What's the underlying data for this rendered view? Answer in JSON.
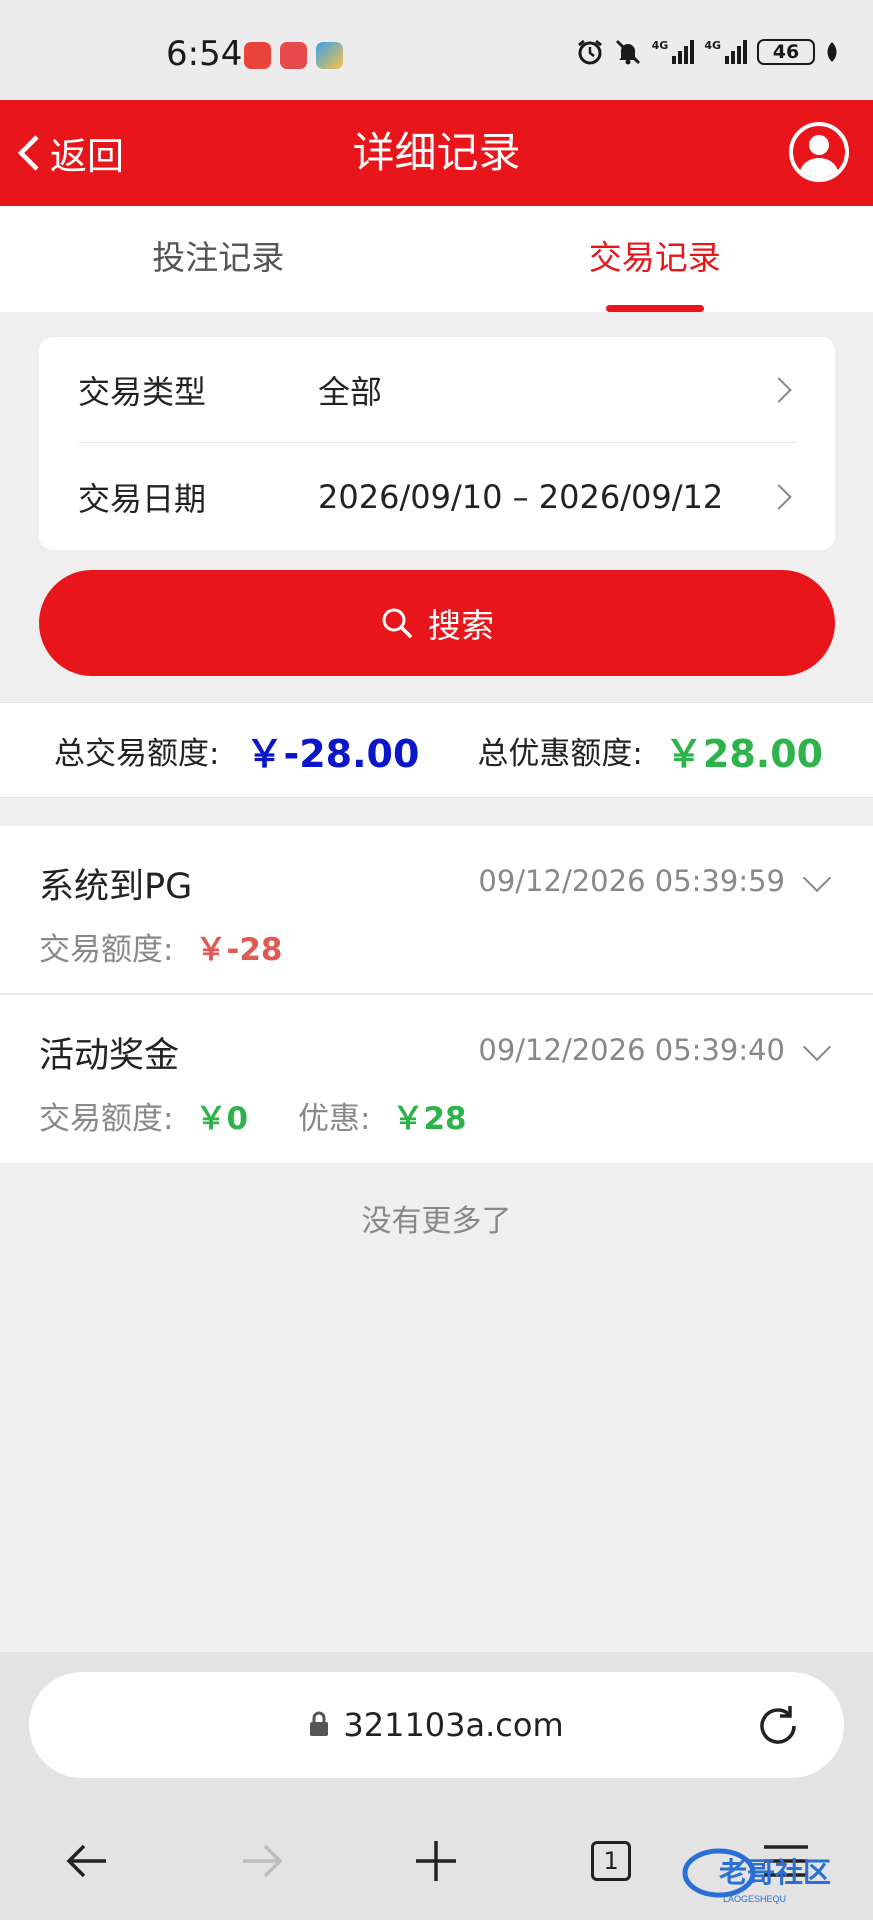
{
  "status_bar": {
    "time": "6:54",
    "app_icons": [
      "phone-app-icon",
      "huawei-appgallery-icon",
      "weather-app-icon"
    ],
    "status_icons": [
      "alarm-icon",
      "mute-icon",
      "signal-4g-icon",
      "signal-4g-icon"
    ],
    "signal_label_1": "4G",
    "signal_label_2": "4G",
    "battery": "46"
  },
  "header": {
    "back_label": "返回",
    "title": "详细记录",
    "accent_color": "#e8161b"
  },
  "tabs": [
    {
      "label": "投注记录",
      "active": false
    },
    {
      "label": "交易记录",
      "active": true
    }
  ],
  "filter": {
    "type_label": "交易类型",
    "type_value": "全部",
    "date_label": "交易日期",
    "date_value": "2026/09/10 – 2026/09/12"
  },
  "search": {
    "label": "搜索"
  },
  "totals": {
    "trade_label": "总交易额度:",
    "trade_value": "￥-28.00",
    "bonus_label": "总优惠额度:",
    "bonus_value": "￥28.00"
  },
  "records": [
    {
      "title": "系统到PG",
      "time": "09/12/2026 05:39:59",
      "amount_label": "交易额度:",
      "amount": "￥-28"
    },
    {
      "title": "活动奖金",
      "time": "09/12/2026 05:39:40",
      "amount_label": "交易额度:",
      "amount": "￥0",
      "bonus_label": "优惠:",
      "bonus": "￥28"
    }
  ],
  "no_more": "没有更多了",
  "browser": {
    "url": "321103a.com",
    "tab_count": "1"
  },
  "watermark": {
    "text": "老哥社区",
    "subtext": "LAOGESHEQU"
  }
}
